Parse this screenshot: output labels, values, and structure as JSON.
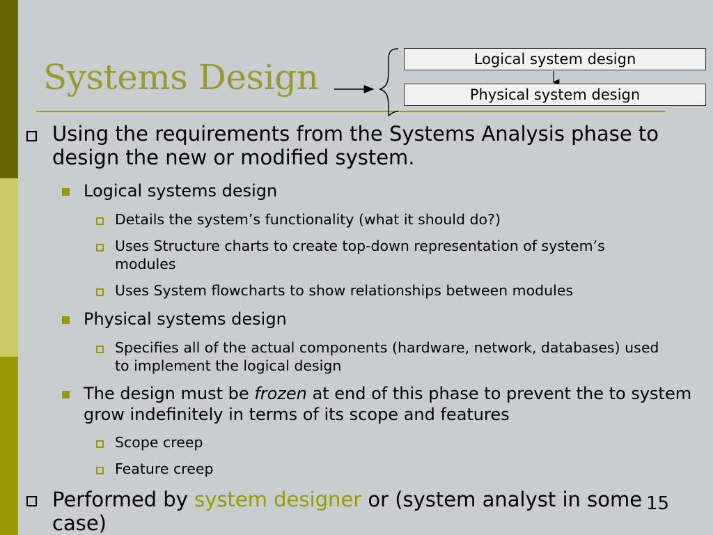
{
  "slide": {
    "title": "Systems Design",
    "number": "15",
    "colors": {
      "title": "#999933",
      "accent": "#999900",
      "background": "#c8ced0"
    }
  },
  "diagram": {
    "top_box": "Logical system design",
    "bottom_box": "Physical system design"
  },
  "bullets": {
    "b1": "Using the requirements from the Systems Analysis phase to design the new or modified system.",
    "b1_1": "Logical systems design",
    "b1_1_1": "Details the system’s functionality (what it should do?)",
    "b1_1_2": "Uses Structure charts to create top-down representation of system’s modules",
    "b1_1_3": "Uses System flowcharts to show relationships between modules",
    "b1_2": "Physical systems design",
    "b1_2_1": "Specifies all of the actual components (hardware, network, databases) used to implement the logical design",
    "b1_3": {
      "before": "The design must be ",
      "emph": "frozen",
      "after": " at end of this phase to prevent the to system grow indefinitely in terms of its scope and features"
    },
    "b1_3_1": "Scope creep",
    "b1_3_2": "Feature creep",
    "b2": {
      "before": "Performed by ",
      "highlight": "system designer",
      "after": " or (system analyst in some case)"
    }
  }
}
